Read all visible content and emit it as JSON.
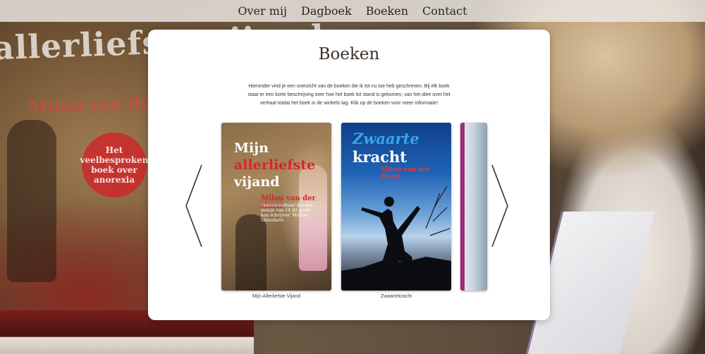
{
  "nav": {
    "items": [
      "Over mij",
      "Dagboek",
      "Boeken",
      "Contact"
    ]
  },
  "background": {
    "book_title": "allerliefste vijand",
    "book_author": "Milou van der Horst",
    "sticker": "Het veelbesproken boek over anorexia"
  },
  "page": {
    "title": "Boeken",
    "intro": "Hieronder vind je een overzicht van de boeken die ik tot nu toe heb geschreven. Bij elk boek staat er een korte beschrijving over hoe het boek tot stand is gekomen, van het idee over het verhaal totdat het boek in de winkels lag. Klik op de boeken voor meer informatie!"
  },
  "books": [
    {
      "title_line1": "Mijn",
      "title_line2": "allerliefste",
      "title_line3": "vijand",
      "author": "Milou van der Horst",
      "quote": "'Onvoorstelbaar dat een meisje van 14 dit goed kan schrijven' Mirjam Oldenhave",
      "caption": "Mijn Allerliefste Vijand"
    },
    {
      "title_line1": "Zwaarte",
      "title_line2": "kracht",
      "author": "Milou van der Horst",
      "caption": "Zwaartekracht"
    }
  ],
  "colors": {
    "nav_bg": "#eeeae6",
    "panel_bg": "#ffffff",
    "accent_red": "#d8242a",
    "accent_blue": "#37a6e8"
  },
  "icons": {
    "prev": "chevron-left-icon",
    "next": "chevron-right-icon"
  }
}
